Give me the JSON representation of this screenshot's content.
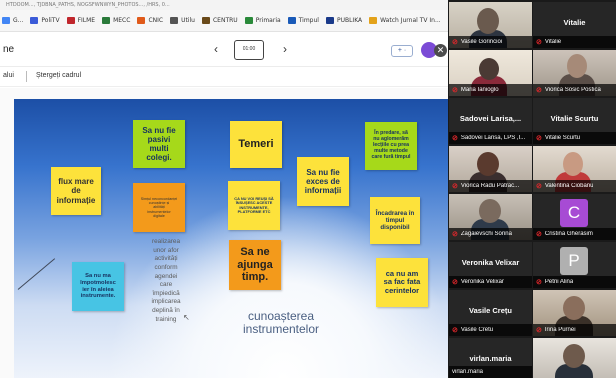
{
  "browser": {
    "url_text": "HTDOOM..., TJDBNA_PATHS, NOGSFWNWYN_PHOTOS..., /HRS, 0...",
    "bookmarks": [
      {
        "label": "G...",
        "color": "#4285f4"
      },
      {
        "label": "PoliTV",
        "color": "#3b5bd8"
      },
      {
        "label": "FILME",
        "color": "#c0262c"
      },
      {
        "label": "MECC",
        "color": "#2a7a3a"
      },
      {
        "label": "CNIC",
        "color": "#e05a1a"
      },
      {
        "label": "Utilu",
        "color": "#555555"
      },
      {
        "label": "CENTRU",
        "color": "#6a4a1a"
      },
      {
        "label": "Primaria",
        "color": "#2a8a3a"
      },
      {
        "label": "Timpul",
        "color": "#1a5ab8"
      },
      {
        "label": "PUBLIKA",
        "color": "#1a3a8a"
      },
      {
        "label": "Watch Jurnal TV In...",
        "color": "#e3a21a"
      }
    ]
  },
  "app": {
    "title": "ne",
    "prev_arrow": "‹",
    "next_arrow": "›",
    "page_thumb_label": "01:00",
    "add_button": "+ ·",
    "brand_glyph": "✕",
    "undo_label": "alui",
    "clear_label": "Ștergeți cadrul"
  },
  "board": {
    "notes": [
      {
        "text": [
          "flux mare",
          "de",
          "informație"
        ],
        "color": "y"
      },
      {
        "text": [
          "Sa nu fie",
          "pasivi",
          "multi",
          "colegi."
        ],
        "color": "g"
      },
      {
        "text": [
          "Temeri"
        ],
        "color": "y"
      },
      {
        "text": [
          "Sa nu fie",
          "exces de",
          "informații"
        ],
        "color": "y"
      },
      {
        "text": [
          "În predare, să",
          "nu aglomerăm",
          "lecțiile cu prea",
          "multe metode",
          "care fură timpul"
        ],
        "color": "g"
      },
      {
        "text": [
          "Simțul neconcordanței",
          "cunoștințe și",
          "abilități",
          "instrumentelor",
          "digitale"
        ],
        "color": "o"
      },
      {
        "text": [
          "CA NU VOI REUȘI SĂ",
          "ÎNSUȘESC ACESTE",
          "INSTRUMENTE,",
          "PLATFORME ETC"
        ],
        "color": "y"
      },
      {
        "text": [
          "Încadrarea în",
          "timpul",
          "disponibil"
        ],
        "color": "y"
      },
      {
        "text": [
          "Sa nu ma",
          "împotmolesc",
          "ier în aleiea",
          "instrumente."
        ],
        "color": "c"
      },
      {
        "text": [
          "Sa ne",
          "ajunga",
          "timp."
        ],
        "color": "o"
      },
      {
        "text": [
          "ca nu am",
          "sa fac fata",
          "cerintelor"
        ],
        "color": "y"
      }
    ],
    "free_text": [
      "realizarea",
      "unor afor",
      "activități",
      "conform",
      "agendei",
      "care",
      "împiedică",
      "implicarea",
      "deplină în",
      "training"
    ],
    "big_text": [
      "cunoașterea",
      "instrumentelor"
    ],
    "cursor": "↖"
  },
  "participants": [
    {
      "name": "Vasile Gorincioi",
      "mic_muted": true,
      "kind": "video"
    },
    {
      "name": "Vitalie",
      "mic_muted": true,
      "kind": "name",
      "tile_title": "Vitalie"
    },
    {
      "name": "Maria Ianioglo",
      "mic_muted": true,
      "kind": "video"
    },
    {
      "name": "Viorica Sosic Postica",
      "mic_muted": true,
      "kind": "video"
    },
    {
      "name": "Sadovei Larisa, LPS ,I...",
      "mic_muted": true,
      "kind": "name",
      "tile_title": "Sadovei Larisa,..."
    },
    {
      "name": "Vitalie Scurtu",
      "mic_muted": true,
      "kind": "name",
      "tile_title": "Vitalie Scurtu"
    },
    {
      "name": "Viorica Radu Patrac...",
      "mic_muted": true,
      "kind": "video"
    },
    {
      "name": "Valentina Ciobanu",
      "mic_muted": true,
      "kind": "video"
    },
    {
      "name": "Zagaievschi Sorina",
      "mic_muted": true,
      "kind": "video"
    },
    {
      "name": "Cristina Gherasim",
      "mic_muted": true,
      "kind": "letter",
      "letter": "C",
      "letter_color": "#a74bd4"
    },
    {
      "name": "Veronika Velixar",
      "mic_muted": true,
      "kind": "name",
      "tile_title": "Veronika Velixar"
    },
    {
      "name": "Petrii Alina",
      "mic_muted": true,
      "kind": "letter",
      "letter": "P",
      "letter_color": "#b0b0b0"
    },
    {
      "name": "Vasile Cretu",
      "mic_muted": true,
      "kind": "name",
      "tile_title": "Vasile Crețu"
    },
    {
      "name": "Irina Purnei",
      "mic_muted": true,
      "kind": "video"
    },
    {
      "name": "virlan.maria",
      "mic_muted": false,
      "kind": "name",
      "tile_title": "virlan.maria"
    },
    {
      "name": "",
      "mic_muted": false,
      "kind": "video"
    }
  ]
}
